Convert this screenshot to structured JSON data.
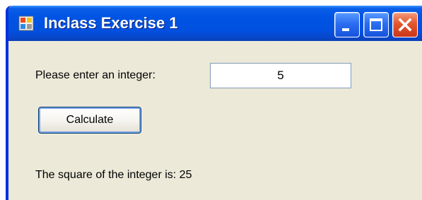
{
  "window": {
    "title": "Inclass Exercise 1",
    "icons": {
      "app": "windows-form-icon",
      "minimize": "minimize-icon",
      "maximize": "maximize-icon",
      "close": "close-icon"
    },
    "colors": {
      "titlebar": "#0054e3",
      "body": "#ece9d8",
      "close_button": "#e4572c"
    }
  },
  "form": {
    "prompt_label": "Please enter an integer:",
    "integer_value": "5",
    "calculate_label": "Calculate",
    "result_text": "The square of the integer is: 25"
  }
}
